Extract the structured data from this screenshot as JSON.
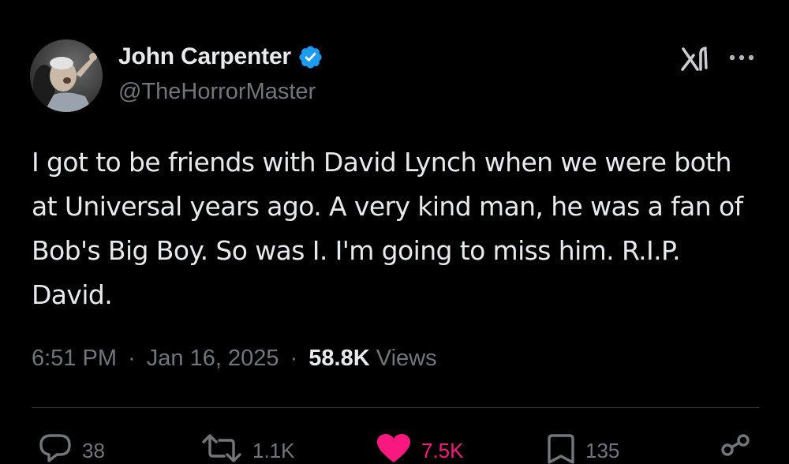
{
  "author": {
    "display_name": "John Carpenter",
    "handle": "@TheHorrorMaster",
    "verified": true,
    "avatar_icon": "avatar-photo"
  },
  "header_icons": {
    "grok": "grok-icon",
    "more": "more-options-icon"
  },
  "tweet": {
    "text": "I got to be friends with David Lynch when we were both at Universal years ago. A very kind man, he was a fan of Bob's Big Boy. So was I. I'm going to miss him. R.I.P. David.",
    "time": "6:51 PM",
    "separator": "·",
    "date": "Jan 16, 2025",
    "views_count": "58.8K",
    "views_label": "Views"
  },
  "actions": {
    "reply": {
      "icon": "reply-icon",
      "count": "38"
    },
    "repost": {
      "icon": "repost-icon",
      "count": "1.1K"
    },
    "like": {
      "icon": "heart-icon",
      "count": "7.5K",
      "liked": true
    },
    "bookmark": {
      "icon": "bookmark-icon",
      "count": "135"
    },
    "share": {
      "icon": "share-icon"
    }
  },
  "colors": {
    "background": "#000000",
    "primary_text": "#e7e9ea",
    "secondary_text": "#71767b",
    "verified_blue": "#1d9bf0",
    "like_pink": "#f91880",
    "divider": "#2f3336"
  }
}
